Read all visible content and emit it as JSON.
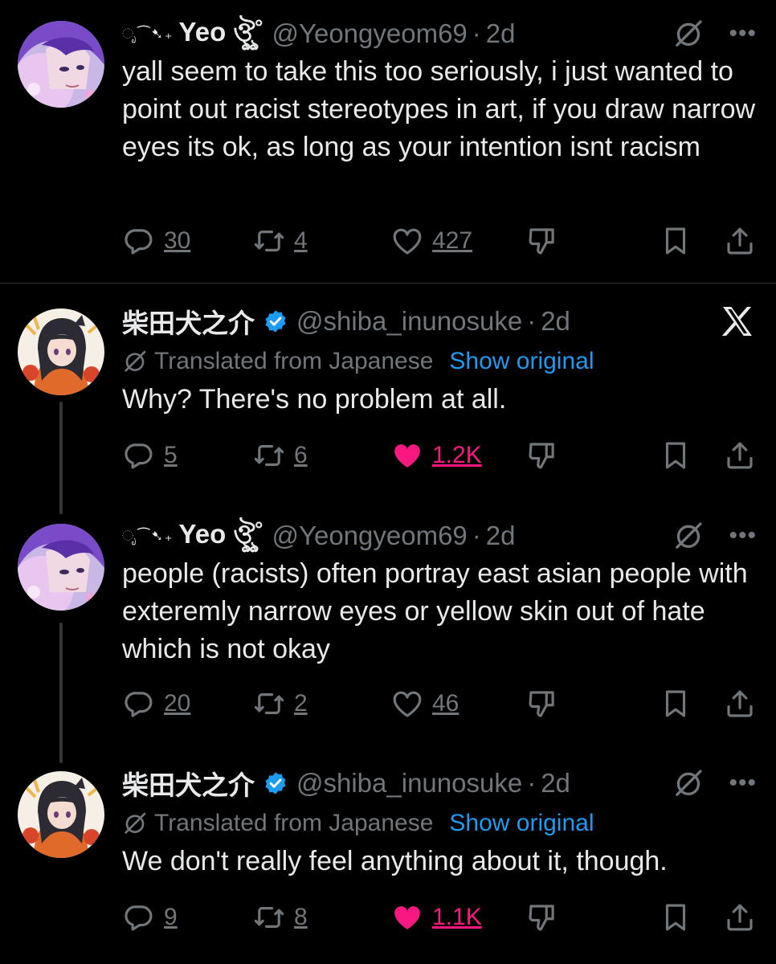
{
  "tweets": [
    {
      "deco": "ೃ⁀➷₊",
      "name": "Yeo ঔৣ˚",
      "handle": "@Yeongyeom69",
      "dot": "·",
      "time": "2d",
      "text": "yall seem to take this too seriously, i just wanted to point out racist stereotypes in art, if you draw narrow eyes its ok, as long as your intention isnt racism",
      "replies": "30",
      "reposts": "4",
      "likes": "427"
    },
    {
      "name": "柴田犬之介",
      "handle": "@shiba_inunosuke",
      "dot": "·",
      "time": "2d",
      "translated": "Translated from Japanese",
      "show_original": "Show original",
      "text": "Why? There's no problem at all.",
      "replies": "5",
      "reposts": "6",
      "likes": "1.2K"
    },
    {
      "deco": "ೃ⁀➷₊",
      "name": "Yeo ঔৣ˚",
      "handle": "@Yeongyeom69",
      "dot": "·",
      "time": "2d",
      "text": "people (racists) often portray east asian people with exteremly narrow eyes or yellow skin out of hate which is not okay",
      "replies": "20",
      "reposts": "2",
      "likes": "46"
    },
    {
      "name": "柴田犬之介",
      "handle": "@shiba_inunosuke",
      "dot": "·",
      "time": "2d",
      "translated": "Translated from Japanese",
      "show_original": "Show original",
      "text": "We don't really feel anything about it, though.",
      "replies": "9",
      "reposts": "8",
      "likes": "1.1K"
    }
  ],
  "colors": {
    "background": "#000000",
    "text": "#e7e9ea",
    "secondary": "#71767b",
    "link": "#1d9bf0",
    "like": "#f91880",
    "verified": "#1d9bf0"
  }
}
